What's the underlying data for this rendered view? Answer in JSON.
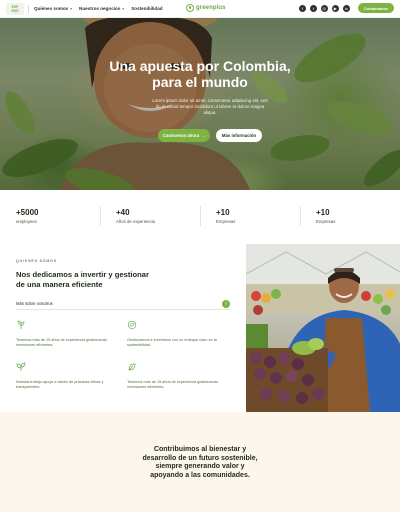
{
  "nav": {
    "lang_top": "ESP",
    "lang_bottom": "ENG",
    "links": [
      {
        "label": "Quiénes somos"
      },
      {
        "label": "Nuestros negocios"
      },
      {
        "label": "Sostenibilidad"
      }
    ],
    "logo_text": "greenplus",
    "social_icons": [
      "facebook-icon",
      "twitter-icon",
      "instagram-icon",
      "youtube-icon",
      "linkedin-icon"
    ],
    "contact_label": "Contáctanos"
  },
  "hero": {
    "title": "Una apuesta por Colombia,\npara el mundo",
    "subtitle": "Lorem ipsum dolor sit amet, consectetur adipiscing elit, sed do eiusmod tempor incididunt ut labore et dolore magna aliqua.",
    "primary_button": "Conócenos ahora",
    "primary_arrow": "→",
    "secondary_button": "Más información"
  },
  "stats": [
    {
      "value": "+5000",
      "label": "employees"
    },
    {
      "value": "+40",
      "label": "Años de experiencia"
    },
    {
      "value": "+10",
      "label": "Empresas"
    },
    {
      "value": "+10",
      "label": "Empresas"
    }
  ],
  "about": {
    "eyebrow": "QUIENES SOMOS",
    "title": "Nos dedicamos a invertir y gestionar\nde una manera eficiente",
    "more_label": "Más sobre nosotros",
    "more_arrow": "›",
    "features": [
      {
        "icon": "plant-icon",
        "text": "Tenemos más de 15 años de experiencia gestionando inversiones eficientes."
      },
      {
        "icon": "leaf-cycle-icon",
        "text": "Gestionamos e invertimos con un enfoque claro en la sostenibilidad."
      },
      {
        "icon": "sprout-icon",
        "text": "Nuestra trabajo apoya a través de prácticas éticas y transparentes."
      },
      {
        "icon": "leaf-icon",
        "text": "Tenemos más de 15 años de experiencia gestionando inversiones eficientes."
      }
    ]
  },
  "bottom": {
    "text": "Contribuimos al bienestar y\ndesarrollo de un futuro sostenible,\nsiempre generando valor y\napoyando a las comunidades."
  },
  "colors": {
    "brand_green": "#7cb342",
    "dark_text": "#1f2a1c",
    "bottom_bg": "#fdf6ec"
  }
}
